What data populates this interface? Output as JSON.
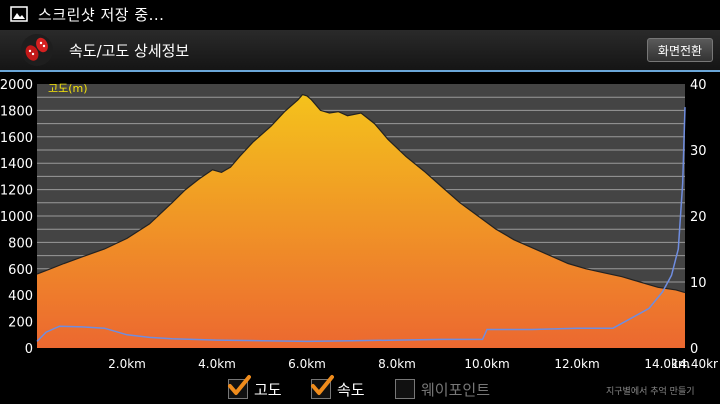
{
  "statusbar": {
    "text": "스크린샷 저장 중...",
    "icon": "image-icon"
  },
  "header": {
    "title": "속도/고도 상세정보",
    "icon": "footprints-icon",
    "toggle_button": "화면전환"
  },
  "colors": {
    "accent": "#6aa6d8",
    "fill_top": "#f4c21c",
    "fill_bottom": "#ec6830",
    "speed_line": "#6f8de0",
    "check": "#f08c1c"
  },
  "footer": {
    "options": [
      {
        "label": "고도",
        "checked": true
      },
      {
        "label": "속도",
        "checked": true
      },
      {
        "label": "웨이포인트",
        "checked": false
      }
    ]
  },
  "watermark": "지구별에서 추억 만들기",
  "chart_data": {
    "type": "area",
    "series_label": "고도(m)",
    "x_unit": "km",
    "xlim": [
      0,
      14.4
    ],
    "xticks": [
      "2.0km",
      "4.0km",
      "6.0km",
      "8.0km",
      "10.0km",
      "12.0km",
      "14.0km",
      "14.40kr"
    ],
    "ylim_left": [
      0,
      2000
    ],
    "yticks_left": [
      "2000",
      "1800",
      "1600",
      "1400",
      "1200",
      "1000",
      "800",
      "600",
      "400",
      "200",
      "0"
    ],
    "ylim_right": [
      0,
      40
    ],
    "yticks_right": [
      "40",
      "30",
      "20",
      "10",
      "0"
    ],
    "grid": true,
    "series": [
      {
        "name": "고도",
        "axis": "left",
        "x": [
          0.0,
          0.3,
          0.6,
          1.0,
          1.5,
          2.0,
          2.5,
          3.0,
          3.3,
          3.6,
          3.9,
          4.1,
          4.3,
          4.5,
          4.8,
          5.2,
          5.5,
          5.8,
          5.9,
          6.0,
          6.1,
          6.3,
          6.5,
          6.7,
          6.9,
          7.2,
          7.5,
          7.8,
          8.2,
          8.6,
          9.0,
          9.4,
          9.8,
          10.2,
          10.6,
          11.0,
          11.4,
          11.8,
          12.2,
          12.6,
          13.0,
          13.4,
          13.8,
          14.2,
          14.4
        ],
        "values": [
          560,
          600,
          640,
          690,
          750,
          830,
          940,
          1100,
          1200,
          1280,
          1350,
          1330,
          1370,
          1450,
          1560,
          1680,
          1790,
          1880,
          1920,
          1910,
          1880,
          1800,
          1780,
          1790,
          1760,
          1780,
          1700,
          1580,
          1450,
          1340,
          1220,
          1100,
          1000,
          900,
          820,
          760,
          700,
          640,
          600,
          570,
          540,
          500,
          460,
          440,
          420
        ]
      },
      {
        "name": "속도",
        "axis": "right",
        "x": [
          0.0,
          0.2,
          0.5,
          1.0,
          1.5,
          2.0,
          2.5,
          3.0,
          4.0,
          5.0,
          6.0,
          7.0,
          8.0,
          9.0,
          9.9,
          10.0,
          11.0,
          12.0,
          12.8,
          13.2,
          13.6,
          13.9,
          14.1,
          14.25,
          14.35,
          14.4
        ],
        "values": [
          1.0,
          2.4,
          3.3,
          3.2,
          3.0,
          2.0,
          1.6,
          1.4,
          1.2,
          1.1,
          1.0,
          1.1,
          1.2,
          1.3,
          1.3,
          2.8,
          2.8,
          3.0,
          3.0,
          4.5,
          6.0,
          8.5,
          11.0,
          15.0,
          25.0,
          36.5
        ]
      }
    ]
  }
}
